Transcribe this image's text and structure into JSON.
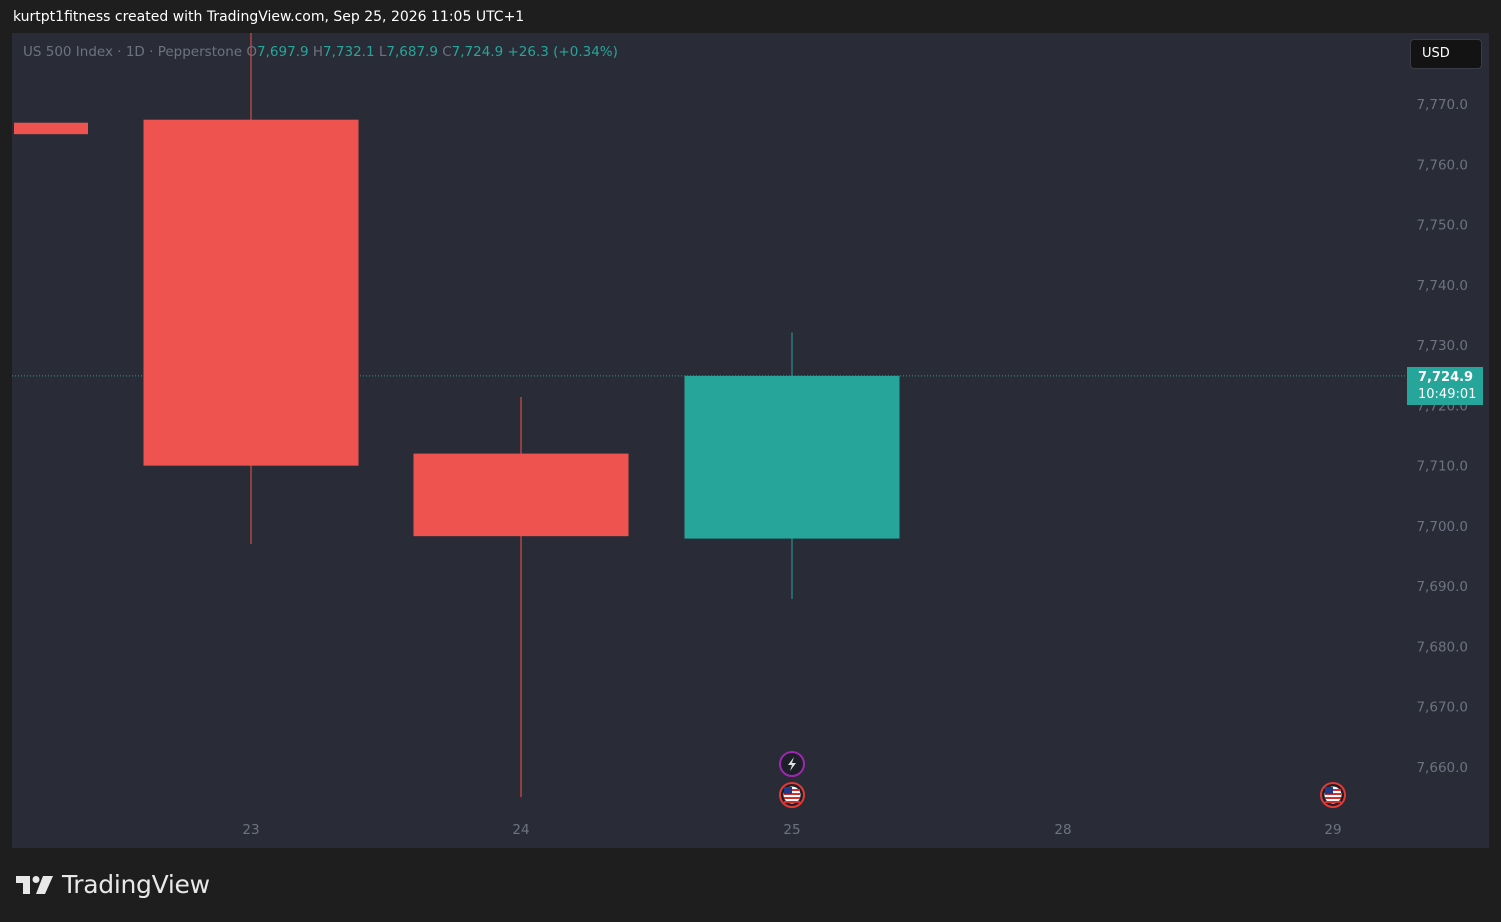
{
  "header": {
    "caption": "kurtpt1fitness created with TradingView.com, Sep 25, 2026 11:05 UTC+1"
  },
  "legend": {
    "symbol": "US 500 Index · 1D · Pepperstone",
    "open_label": "O",
    "open_value": "7,697.9",
    "high_label": "H",
    "high_value": "7,732.1",
    "low_label": "L",
    "low_value": "7,687.9",
    "close_label": "C",
    "close_value": "7,724.9",
    "change": "+26.3 (+0.34%)"
  },
  "currency_button": "USD",
  "last_price": {
    "price": "7,724.9",
    "countdown": "10:49:01"
  },
  "footer": {
    "brand": "TradingView"
  },
  "colors": {
    "up": "#26a69a",
    "down": "#ef5350",
    "background": "#292c36",
    "axis_text": "#6e7280",
    "event_purple": "#9c27b0",
    "event_red": "#e53935"
  },
  "chart_data": {
    "type": "candlestick",
    "title": "",
    "xlabel": "",
    "ylabel": "",
    "x_ticks": [
      "23",
      "24",
      "25",
      "28",
      "29"
    ],
    "y_ticks": [
      "7,660.0",
      "7,670.0",
      "7,680.0",
      "7,690.0",
      "7,700.0",
      "7,710.0",
      "7,720.0",
      "7,730.0",
      "7,740.0",
      "7,750.0",
      "7,760.0",
      "7,770.0"
    ],
    "y_tick_values": [
      7660,
      7670,
      7680,
      7690,
      7700,
      7710,
      7720,
      7730,
      7740,
      7750,
      7760,
      7770
    ],
    "ylim": [
      7652.0,
      7777.5
    ],
    "grid": false,
    "candles": [
      {
        "x": "22",
        "open": 7766.9,
        "high": 7766.9,
        "low": 7765.0,
        "close": 7765.0,
        "partial": true
      },
      {
        "x": "23",
        "open": 7767.4,
        "high": 7791.0,
        "low": 7697.0,
        "close": 7710.0
      },
      {
        "x": "24",
        "open": 7712.0,
        "high": 7721.4,
        "low": 7655.0,
        "close": 7698.3
      },
      {
        "x": "25",
        "open": 7697.9,
        "high": 7732.1,
        "low": 7687.9,
        "close": 7724.9
      }
    ],
    "last_price": 7724.9,
    "events": [
      {
        "x": "25",
        "icon": "lightning-icon"
      },
      {
        "x": "25",
        "icon": "us-flag-icon"
      },
      {
        "x": "29",
        "icon": "us-flag-icon"
      }
    ]
  }
}
